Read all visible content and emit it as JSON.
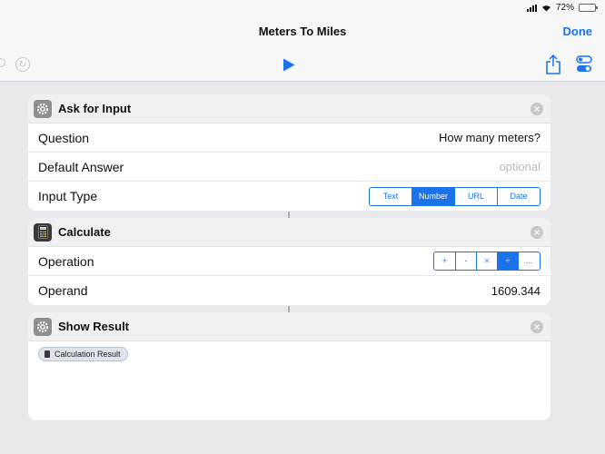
{
  "status": {
    "battery": "72%",
    "battery_level": 0.72
  },
  "header": {
    "title": "Meters To Miles",
    "done_label": "Done"
  },
  "toolbar": {
    "undo_icon": "undo-icon",
    "redo_icon": "redo-icon",
    "play_icon": "play-icon",
    "share_icon": "share-icon",
    "settings_icon": "toggles-icon",
    "accent_color": "#1a73e8"
  },
  "actions": [
    {
      "title": "Ask for Input",
      "icon": "gear-icon",
      "rows": [
        {
          "label": "Question",
          "value": "How many meters?"
        },
        {
          "label": "Default Answer",
          "placeholder": "optional"
        },
        {
          "label": "Input Type",
          "options": [
            "Text",
            "Number",
            "URL",
            "Date"
          ],
          "selected": "Number"
        }
      ]
    },
    {
      "title": "Calculate",
      "icon": "calculator-icon",
      "rows": [
        {
          "label": "Operation",
          "options": [
            "+",
            "-",
            "×",
            "÷",
            "..."
          ],
          "selected": "÷"
        },
        {
          "label": "Operand",
          "value": "1609.344"
        }
      ]
    },
    {
      "title": "Show Result",
      "icon": "gear-icon",
      "variable": {
        "label": "Calculation Result",
        "icon": "calculator-icon"
      }
    }
  ]
}
